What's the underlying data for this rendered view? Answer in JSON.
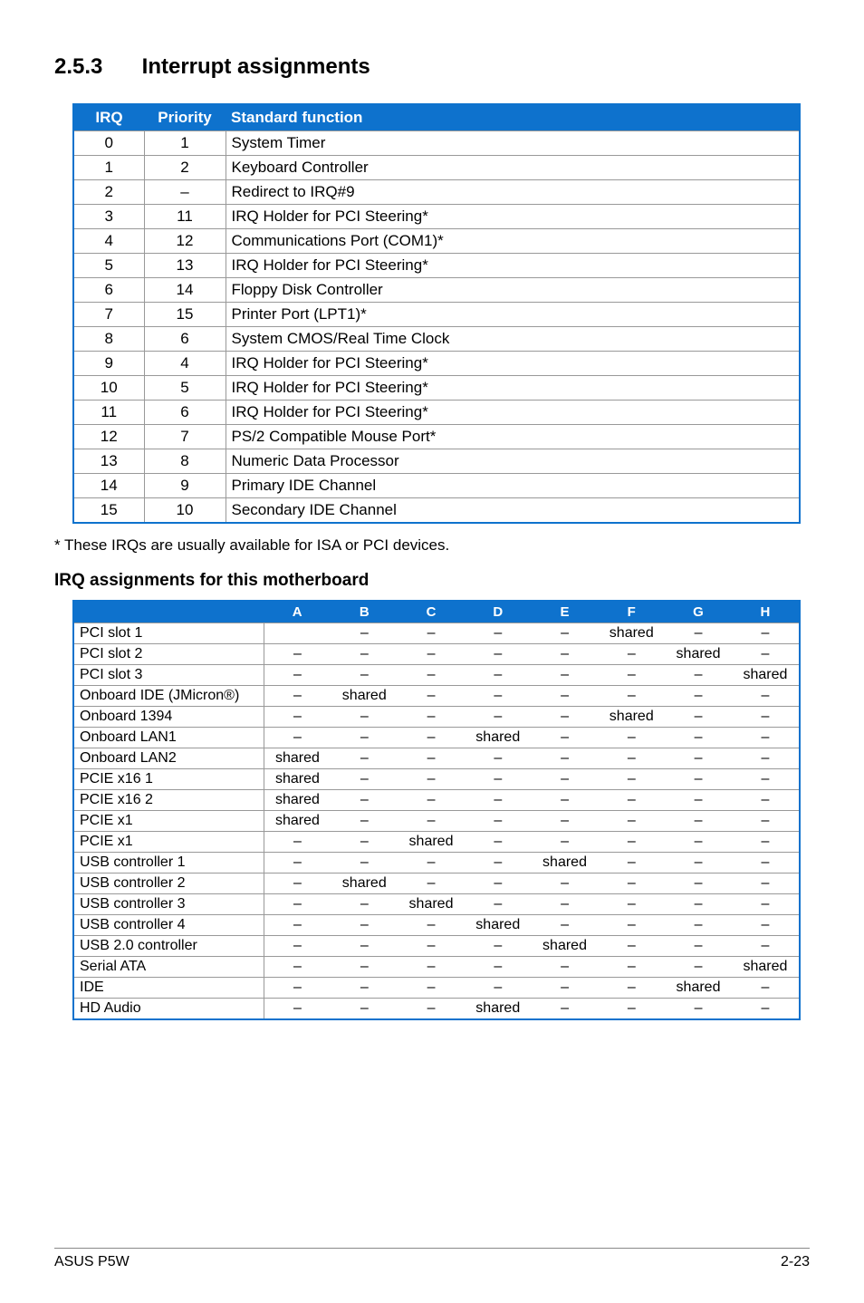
{
  "section": {
    "number": "2.5.3",
    "title": "Interrupt assignments"
  },
  "irq_table": {
    "headers": [
      "IRQ",
      "Priority",
      "Standard function"
    ],
    "rows": [
      {
        "irq": "0",
        "priority": "1",
        "func": "System Timer"
      },
      {
        "irq": "1",
        "priority": "2",
        "func": "Keyboard Controller"
      },
      {
        "irq": "2",
        "priority": "–",
        "func": "Redirect to IRQ#9"
      },
      {
        "irq": "3",
        "priority": "11",
        "func": "IRQ Holder for PCI Steering*"
      },
      {
        "irq": "4",
        "priority": "12",
        "func": "Communications Port (COM1)*"
      },
      {
        "irq": "5",
        "priority": "13",
        "func": "IRQ Holder for PCI Steering*"
      },
      {
        "irq": "6",
        "priority": "14",
        "func": "Floppy Disk Controller"
      },
      {
        "irq": "7",
        "priority": "15",
        "func": "Printer Port (LPT1)*"
      },
      {
        "irq": "8",
        "priority": "6",
        "func": "System CMOS/Real Time Clock"
      },
      {
        "irq": "9",
        "priority": "4",
        "func": "IRQ Holder for PCI Steering*"
      },
      {
        "irq": "10",
        "priority": "5",
        "func": "IRQ Holder for PCI Steering*"
      },
      {
        "irq": "11",
        "priority": "6",
        "func": "IRQ Holder for PCI Steering*"
      },
      {
        "irq": "12",
        "priority": "7",
        "func": "PS/2 Compatible Mouse Port*"
      },
      {
        "irq": "13",
        "priority": "8",
        "func": "Numeric Data Processor"
      },
      {
        "irq": "14",
        "priority": "9",
        "func": "Primary IDE Channel"
      },
      {
        "irq": "15",
        "priority": "10",
        "func": "Secondary IDE Channel"
      }
    ]
  },
  "footnote": "* These IRQs are usually available for ISA or PCI devices.",
  "subheading": "IRQ assignments for this motherboard",
  "assign_table": {
    "headers": [
      "A",
      "B",
      "C",
      "D",
      "E",
      "F",
      "G",
      "H"
    ],
    "rows": [
      {
        "label": "PCI slot 1",
        "cells": [
          "",
          "–",
          "–",
          "–",
          "–",
          "shared",
          "–",
          "–"
        ]
      },
      {
        "label": "PCI slot 2",
        "cells": [
          "–",
          "–",
          "–",
          "–",
          "–",
          "–",
          "shared",
          "–"
        ]
      },
      {
        "label": "PCI slot 3",
        "cells": [
          "–",
          "–",
          "–",
          "–",
          "–",
          "–",
          "–",
          "shared"
        ]
      },
      {
        "label": "Onboard IDE (JMicron®)",
        "cells": [
          "–",
          "shared",
          "–",
          "–",
          "–",
          "–",
          "–",
          "–"
        ]
      },
      {
        "label": "Onboard 1394",
        "cells": [
          "–",
          "–",
          "–",
          "–",
          "–",
          "shared",
          "–",
          "–"
        ]
      },
      {
        "label": "Onboard LAN1",
        "cells": [
          "–",
          "–",
          "–",
          "shared",
          "–",
          "–",
          "–",
          "–"
        ]
      },
      {
        "label": "Onboard LAN2",
        "cells": [
          "shared",
          "–",
          "–",
          "–",
          "–",
          "–",
          "–",
          "–"
        ]
      },
      {
        "label": "PCIE x16 1",
        "cells": [
          "shared",
          "–",
          "–",
          "–",
          "–",
          "–",
          "–",
          "–"
        ]
      },
      {
        "label": "PCIE x16 2",
        "cells": [
          "shared",
          "–",
          "–",
          "–",
          "–",
          "–",
          "–",
          "–"
        ]
      },
      {
        "label": "PCIE x1",
        "cells": [
          "shared",
          "–",
          "–",
          "–",
          "–",
          "–",
          "–",
          "–"
        ]
      },
      {
        "label": "PCIE x1",
        "cells": [
          "–",
          "–",
          "shared",
          "–",
          "–",
          "–",
          "–",
          "–"
        ]
      },
      {
        "label": "USB controller 1",
        "cells": [
          "–",
          "–",
          "–",
          "–",
          "shared",
          "–",
          "–",
          "–"
        ]
      },
      {
        "label": "USB controller 2",
        "cells": [
          "–",
          "shared",
          "–",
          "–",
          "–",
          "–",
          "–",
          "–"
        ]
      },
      {
        "label": "USB controller 3",
        "cells": [
          "–",
          "–",
          "shared",
          "–",
          "–",
          "–",
          "–",
          "–"
        ]
      },
      {
        "label": "USB controller 4",
        "cells": [
          "–",
          "–",
          "–",
          "shared",
          "–",
          "–",
          "–",
          "–"
        ]
      },
      {
        "label": "USB 2.0 controller",
        "cells": [
          "–",
          "–",
          "–",
          "–",
          "shared",
          "–",
          "–",
          "–"
        ]
      },
      {
        "label": "Serial ATA",
        "cells": [
          "–",
          "–",
          "–",
          "–",
          "–",
          "–",
          "–",
          "shared"
        ]
      },
      {
        "label": "IDE",
        "cells": [
          "–",
          "–",
          "–",
          "–",
          "–",
          "–",
          "shared",
          "–"
        ]
      },
      {
        "label": "HD Audio",
        "cells": [
          "–",
          "–",
          "–",
          "shared",
          "–",
          "–",
          "–",
          "–"
        ]
      }
    ]
  },
  "footer": {
    "left": "ASUS P5W",
    "right": "2-23"
  }
}
